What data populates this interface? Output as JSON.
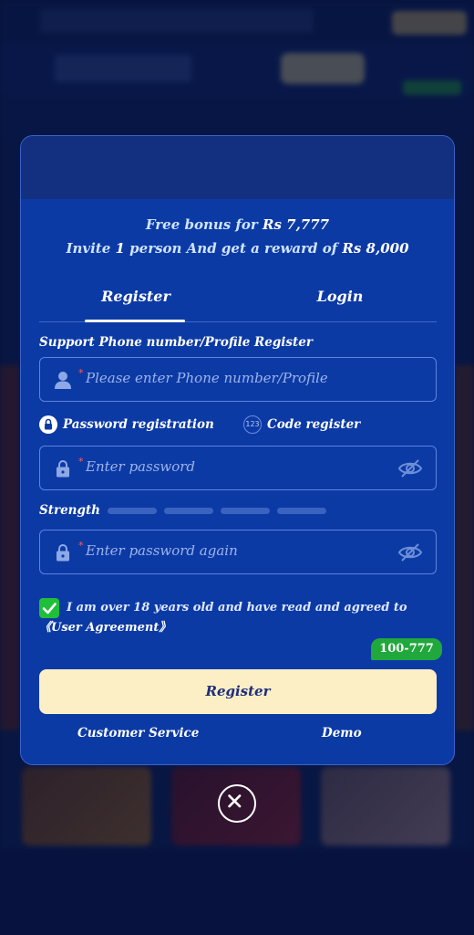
{
  "promo": {
    "line1_prefix": "Free bonus for ",
    "line1_amount": "Rs 7,777",
    "line2_prefix": "Invite ",
    "line2_count": "1",
    "line2_middle": " person And get a reward of ",
    "line2_amount": "Rs 8,000"
  },
  "tabs": [
    {
      "label": "Register",
      "active": true
    },
    {
      "label": "Login",
      "active": false
    }
  ],
  "form": {
    "section_label": "Support Phone number/Profile Register",
    "phone": {
      "required_mark": "*",
      "placeholder": "Please enter Phone number/Profile",
      "icon": "user-icon"
    },
    "modes": [
      {
        "label": "Password registration",
        "icon": "lock-badge-icon",
        "selected": true
      },
      {
        "label": "Code register",
        "icon": "code-123-icon",
        "icon_text": "123",
        "selected": false
      }
    ],
    "password": {
      "required_mark": "*",
      "placeholder": "Enter password",
      "icon": "lock-icon",
      "toggle_icon": "eye-off-icon"
    },
    "strength": {
      "label": "Strength",
      "segments": 4,
      "filled": 0
    },
    "password_again": {
      "required_mark": "*",
      "placeholder": "Enter password again",
      "icon": "lock-icon",
      "toggle_icon": "eye-off-icon"
    },
    "agreement": {
      "checked": true,
      "text": "I am over 18 years old and have read and agreed to",
      "link": "《User Agreement》"
    },
    "chip": "100-777",
    "submit_label": "Register"
  },
  "footer": {
    "customer_service": "Customer Service",
    "demo": "Demo"
  },
  "colors": {
    "modal_bg": "#0c3aa5",
    "submit_bg": "#fcefc6",
    "check_green": "#1fbf3a",
    "required_red": "#ff5b5b"
  }
}
